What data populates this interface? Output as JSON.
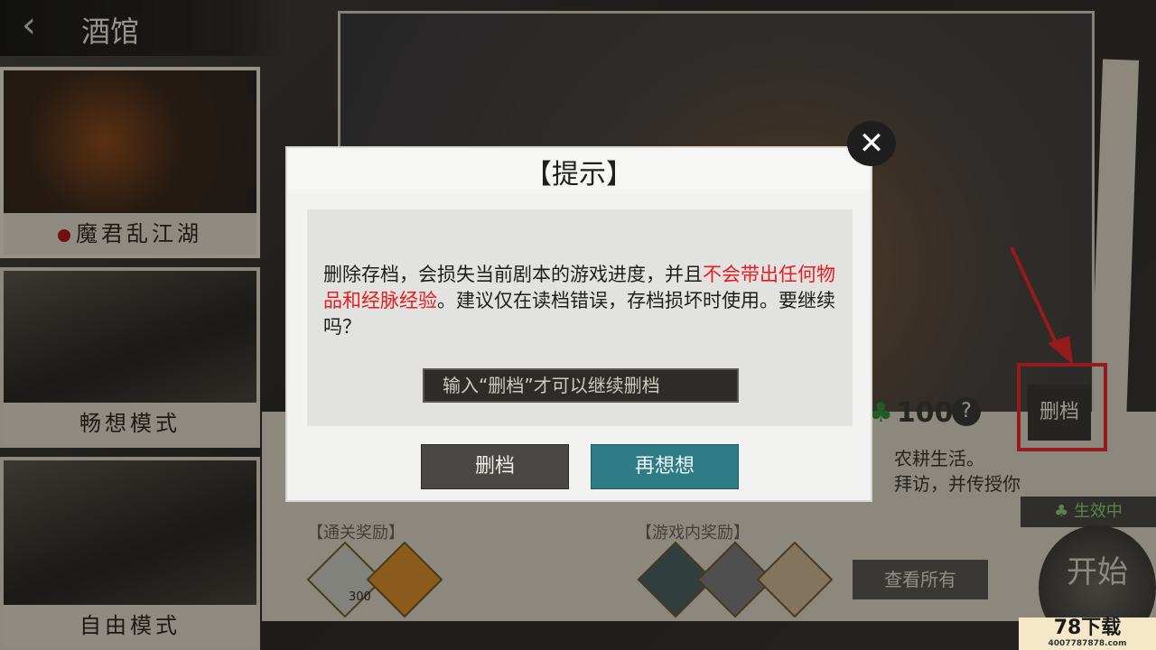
{
  "header": {
    "back_icon": "‹",
    "title": "酒馆"
  },
  "cards": [
    {
      "label": "魔君乱江湖",
      "selected": true
    },
    {
      "label": "畅想模式",
      "selected": false
    },
    {
      "label": "自由模式",
      "selected": false
    }
  ],
  "info": {
    "clover_count": "100",
    "help": "?",
    "delete_tag": "删档",
    "desc_line1": "农耕生活。",
    "desc_line2": "拜访，并传授你",
    "active_badge": "生效中",
    "clear_reward_label": "【通关奖励】",
    "ingame_reward_label": "【游戏内奖励】",
    "silver_count": "300",
    "view_all": "查看所有",
    "start": "开始"
  },
  "dialog": {
    "title": "【提示】",
    "message_part1": "删除存档，会损失当前剧本的游戏进度，并且",
    "message_warn": "不会带出任何物品和经脉经验",
    "message_part2": "。建议仅在读档错误，存档损坏时使用。要继续吗？",
    "input_placeholder": "输入“删档”才可以继续删档",
    "delete_button": "删档",
    "rethink_button": "再想想",
    "close_icon": "✕"
  },
  "watermark": {
    "brand": "78下载",
    "url": "4007787878.com"
  },
  "colors": {
    "warn_text": "#e41e1e",
    "primary_button": "#2e7c86",
    "highlight": "#e8282c"
  }
}
